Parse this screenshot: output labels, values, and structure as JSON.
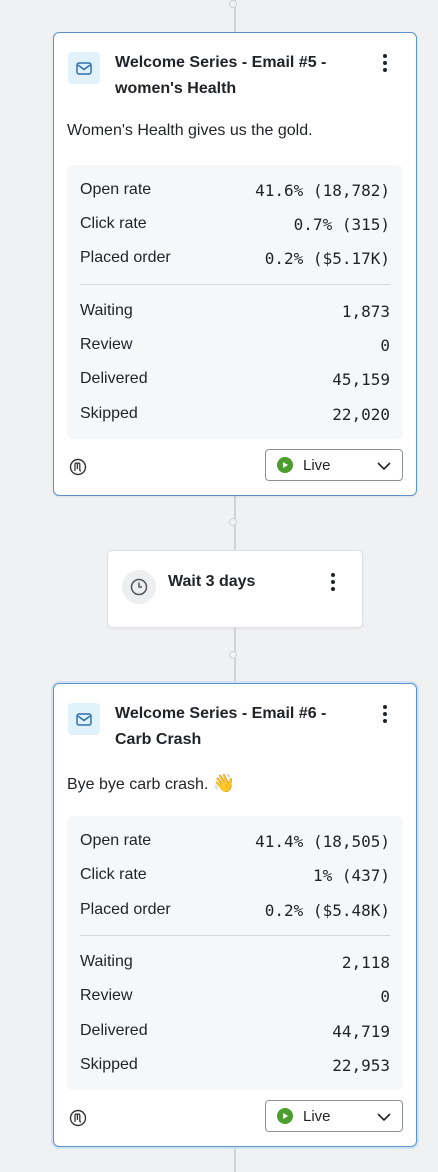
{
  "flow": {
    "emails": [
      {
        "title": "Welcome Series - Email #5 - women's Health",
        "description": "Women's Health gives us the gold.",
        "stats": {
          "open_rate": {
            "label": "Open rate",
            "value": "41.6% (18,782)"
          },
          "click_rate": {
            "label": "Click rate",
            "value": "0.7% (315)"
          },
          "placed_order": {
            "label": "Placed order",
            "value": "0.2% ($5.17K)"
          },
          "waiting": {
            "label": "Waiting",
            "value": "1,873"
          },
          "review": {
            "label": "Review",
            "value": "0"
          },
          "delivered": {
            "label": "Delivered",
            "value": "45,159"
          },
          "skipped": {
            "label": "Skipped",
            "value": "22,020"
          }
        },
        "status": "Live"
      },
      {
        "title": "Welcome Series - Email #6 - Carb Crash",
        "description": "Bye bye carb crash.",
        "emoji": "👋",
        "stats": {
          "open_rate": {
            "label": "Open rate",
            "value": "41.4% (18,505)"
          },
          "click_rate": {
            "label": "Click rate",
            "value": "1% (437)"
          },
          "placed_order": {
            "label": "Placed order",
            "value": "0.2% ($5.48K)"
          },
          "waiting": {
            "label": "Waiting",
            "value": "2,118"
          },
          "review": {
            "label": "Review",
            "value": "0"
          },
          "delivered": {
            "label": "Delivered",
            "value": "44,719"
          },
          "skipped": {
            "label": "Skipped",
            "value": "22,953"
          }
        },
        "status": "Live"
      }
    ],
    "wait": {
      "label": "Wait 3 days"
    }
  },
  "icons": {
    "email": "envelope-icon",
    "menu": "kebab-menu-icon",
    "clock": "clock-icon",
    "logo": "mention-logo-icon",
    "status": "play-icon",
    "dropdown": "chevron-down-icon"
  },
  "colors": {
    "card_border": "#5b93cf",
    "icon_bg": "#e2f2fb",
    "live": "#4a9d2e",
    "canvas": "#f0f1f3"
  }
}
